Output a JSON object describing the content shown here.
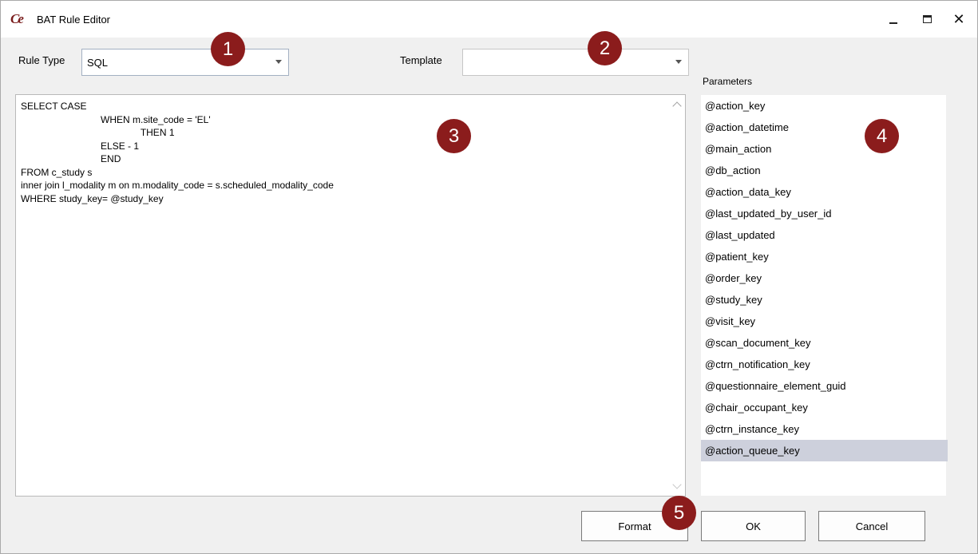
{
  "window": {
    "title": "BAT Rule Editor",
    "icon": "ce-logo-icon",
    "controls": {
      "minimize": "_",
      "maximize": "□",
      "close": "✕"
    }
  },
  "rule_type": {
    "label": "Rule Type",
    "value": "SQL"
  },
  "template": {
    "label": "Template",
    "value": ""
  },
  "editor": {
    "code": "SELECT CASE\n                              WHEN m.site_code = 'EL'\n                                             THEN 1\n                              ELSE - 1\n                              END\nFROM c_study s\ninner join l_modality m on m.modality_code = s.scheduled_modality_code\nWHERE study_key= @study_key"
  },
  "parameters": {
    "label": "Parameters",
    "items": [
      "@action_key",
      "@action_datetime",
      "@main_action",
      "@db_action",
      "@action_data_key",
      "@last_updated_by_user_id",
      "@last_updated",
      "@patient_key",
      "@order_key",
      "@study_key",
      "@visit_key",
      "@scan_document_key",
      "@ctrn_notification_key",
      "@questionnaire_element_guid",
      "@chair_occupant_key",
      "@ctrn_instance_key",
      "@action_queue_key"
    ],
    "selected": "@action_queue_key"
  },
  "buttons": {
    "format": "Format",
    "ok": "OK",
    "cancel": "Cancel"
  },
  "markers": [
    "1",
    "2",
    "3",
    "4",
    "5"
  ],
  "colors": {
    "marker": "#8b1c1c",
    "selection": "#cdd0dc"
  }
}
